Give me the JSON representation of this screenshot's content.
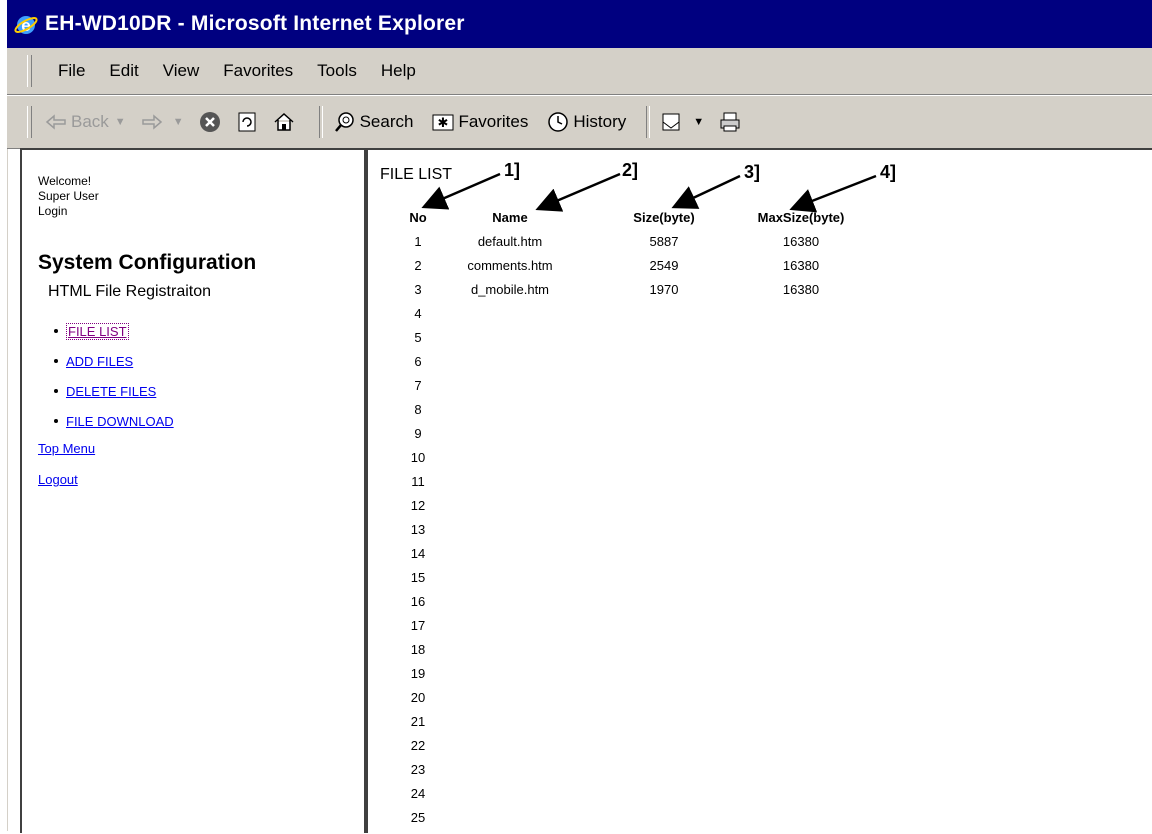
{
  "window": {
    "title": "EH-WD10DR - Microsoft Internet Explorer"
  },
  "menu": [
    "File",
    "Edit",
    "View",
    "Favorites",
    "Tools",
    "Help"
  ],
  "toolbar": {
    "back": "Back",
    "search": "Search",
    "favorites": "Favorites",
    "history": "History"
  },
  "sidebar": {
    "welcome": "Welcome!",
    "user": "Super User",
    "login": "Login",
    "heading": "System Configuration",
    "subheading": "HTML File Registraiton",
    "items": [
      "FILE LIST",
      "ADD FILES",
      "DELETE FILES",
      "FILE DOWNLOAD"
    ],
    "top_menu": "Top Menu",
    "logout": "Logout"
  },
  "main": {
    "title": "FILE LIST",
    "callouts": [
      "1]",
      "2]",
      "3]",
      "4]"
    ],
    "columns": [
      "No",
      "Name",
      "Size(byte)",
      "MaxSize(byte)"
    ],
    "rows": [
      {
        "no": "1",
        "name": "default.htm",
        "size": "5887",
        "max": "16380"
      },
      {
        "no": "2",
        "name": "comments.htm",
        "size": "2549",
        "max": "16380"
      },
      {
        "no": "3",
        "name": "d_mobile.htm",
        "size": "1970",
        "max": "16380"
      },
      {
        "no": "4",
        "name": "",
        "size": "",
        "max": ""
      },
      {
        "no": "5",
        "name": "",
        "size": "",
        "max": ""
      },
      {
        "no": "6",
        "name": "",
        "size": "",
        "max": ""
      },
      {
        "no": "7",
        "name": "",
        "size": "",
        "max": ""
      },
      {
        "no": "8",
        "name": "",
        "size": "",
        "max": ""
      },
      {
        "no": "9",
        "name": "",
        "size": "",
        "max": ""
      },
      {
        "no": "10",
        "name": "",
        "size": "",
        "max": ""
      },
      {
        "no": "11",
        "name": "",
        "size": "",
        "max": ""
      },
      {
        "no": "12",
        "name": "",
        "size": "",
        "max": ""
      },
      {
        "no": "13",
        "name": "",
        "size": "",
        "max": ""
      },
      {
        "no": "14",
        "name": "",
        "size": "",
        "max": ""
      },
      {
        "no": "15",
        "name": "",
        "size": "",
        "max": ""
      },
      {
        "no": "16",
        "name": "",
        "size": "",
        "max": ""
      },
      {
        "no": "17",
        "name": "",
        "size": "",
        "max": ""
      },
      {
        "no": "18",
        "name": "",
        "size": "",
        "max": ""
      },
      {
        "no": "19",
        "name": "",
        "size": "",
        "max": ""
      },
      {
        "no": "20",
        "name": "",
        "size": "",
        "max": ""
      },
      {
        "no": "21",
        "name": "",
        "size": "",
        "max": ""
      },
      {
        "no": "22",
        "name": "",
        "size": "",
        "max": ""
      },
      {
        "no": "23",
        "name": "",
        "size": "",
        "max": ""
      },
      {
        "no": "24",
        "name": "",
        "size": "",
        "max": ""
      },
      {
        "no": "25",
        "name": "",
        "size": "",
        "max": ""
      }
    ]
  },
  "colors": {
    "titlebar": "#000080",
    "chrome": "#d4d0c8",
    "link": "#0000ee",
    "visited": "#800080"
  }
}
